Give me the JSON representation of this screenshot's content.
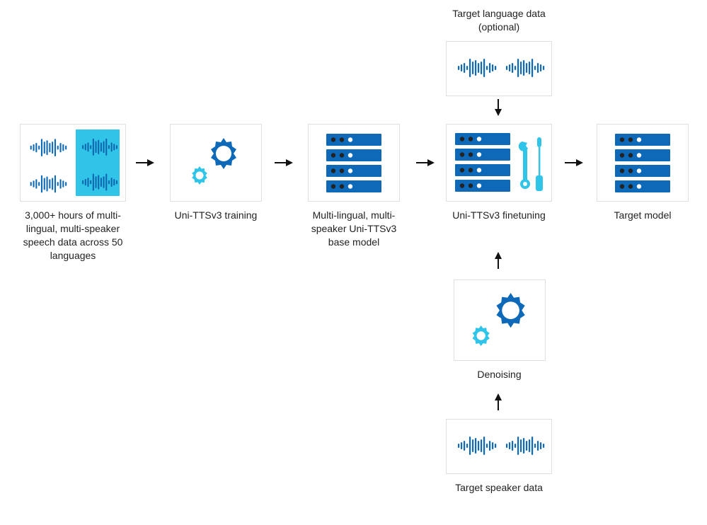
{
  "diagram": {
    "nodes": {
      "input_data": {
        "caption": "3,000+ hours of multi-lingual, multi-speaker speech data across 50 languages"
      },
      "training": {
        "caption": "Uni-TTSv3 training"
      },
      "base_model": {
        "caption": "Multi-lingual, multi-speaker Uni-TTSv3 base model"
      },
      "finetuning": {
        "caption": "Uni-TTSv3 finetuning"
      },
      "target_model": {
        "caption": "Target model"
      },
      "target_lang": {
        "caption": "Target language data (optional)"
      },
      "denoising": {
        "caption": "Denoising"
      },
      "target_speaker": {
        "caption": "Target speaker data"
      }
    },
    "colors": {
      "primary_blue": "#0e6ab8",
      "light_blue": "#2fc4e8",
      "box_border": "#dfdfdf"
    }
  }
}
